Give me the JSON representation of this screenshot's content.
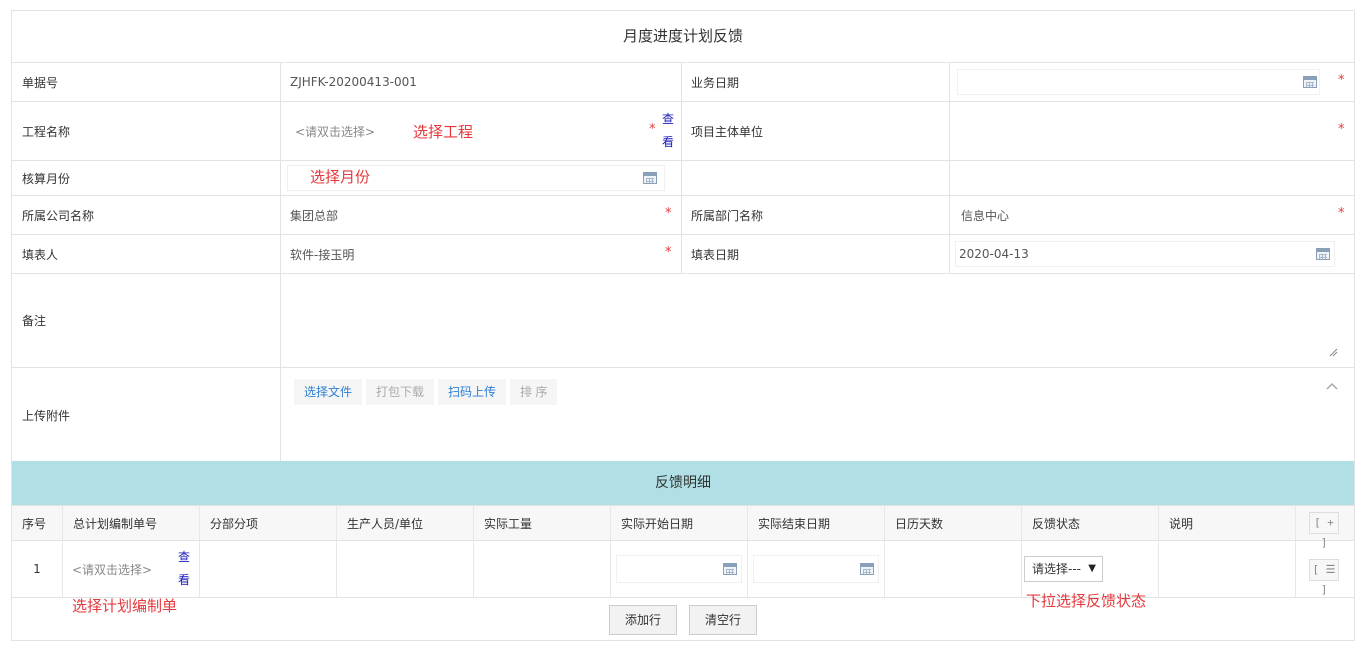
{
  "form": {
    "title": "月度进度计划反馈",
    "fields": {
      "doc_no": {
        "label": "单据号",
        "value": "ZJHFK-20200413-001"
      },
      "biz_date": {
        "label": "业务日期",
        "value": ""
      },
      "project": {
        "label": "工程名称",
        "placeholder": "<请双击选择>",
        "view": "查看"
      },
      "owner_unit": {
        "label": "项目主体单位",
        "value": ""
      },
      "account_month": {
        "label": "核算月份",
        "value": ""
      },
      "company": {
        "label": "所属公司名称",
        "value": "集团总部"
      },
      "department": {
        "label": "所属部门名称",
        "value": "信息中心"
      },
      "filler": {
        "label": "填表人",
        "value": "软件-接玉明"
      },
      "fill_date": {
        "label": "填表日期",
        "value": "2020-04-13"
      },
      "remark": {
        "label": "备注",
        "value": ""
      },
      "attachment": {
        "label": "上传附件"
      }
    },
    "attachment_buttons": {
      "choose": "选择文件",
      "pack": "打包下载",
      "scan": "扫码上传",
      "sort": "排 序"
    },
    "required_mark": "*"
  },
  "annotations": {
    "project": "选择工程",
    "month": "选择月份",
    "plan": "选择计划编制单",
    "status": "下拉选择反馈状态"
  },
  "detail": {
    "title": "反馈明细",
    "columns": [
      "序号",
      "总计划编制单号",
      "分部分项",
      "生产人员/单位",
      "实际工量",
      "实际开始日期",
      "实际结束日期",
      "日历天数",
      "反馈状态",
      "说明"
    ],
    "add_icon": "[ + ]",
    "rows": [
      {
        "index": "1",
        "plan_placeholder": "<请双击选择>",
        "view": "查看",
        "status": "请选择---",
        "menu_icon": "[ ☰ ]"
      }
    ],
    "add_row": "添加行",
    "clear_rows": "清空行"
  },
  "colors": {
    "accent_header": "#b0e0e6",
    "required": "#e4393c",
    "link": "#1a1ab8"
  }
}
